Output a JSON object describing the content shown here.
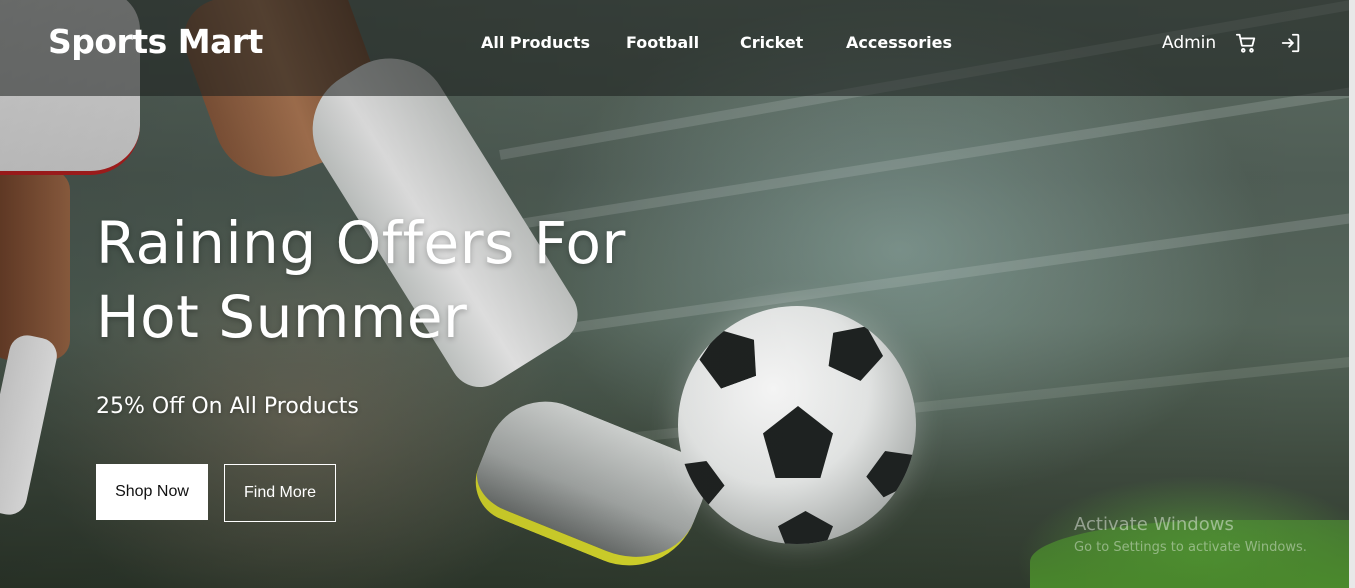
{
  "header": {
    "brand": "Sports Mart",
    "nav": [
      "All Products",
      "Football",
      "Cricket",
      "Accessories"
    ],
    "user": "Admin",
    "icons": [
      "cart-icon",
      "logout-icon"
    ]
  },
  "hero": {
    "title_line1": "Raining Offers For",
    "title_line2": "Hot Summer",
    "subtitle": "25% Off On All Products",
    "primary_button": "Shop Now",
    "secondary_button": "Find More"
  },
  "watermark": {
    "title": "Activate Windows",
    "subtitle": "Go to Settings to activate Windows."
  },
  "colors": {
    "header_bg": "rgba(25,30,28,0.55)",
    "primary_button_bg": "#ffffff",
    "text": "#ffffff"
  }
}
